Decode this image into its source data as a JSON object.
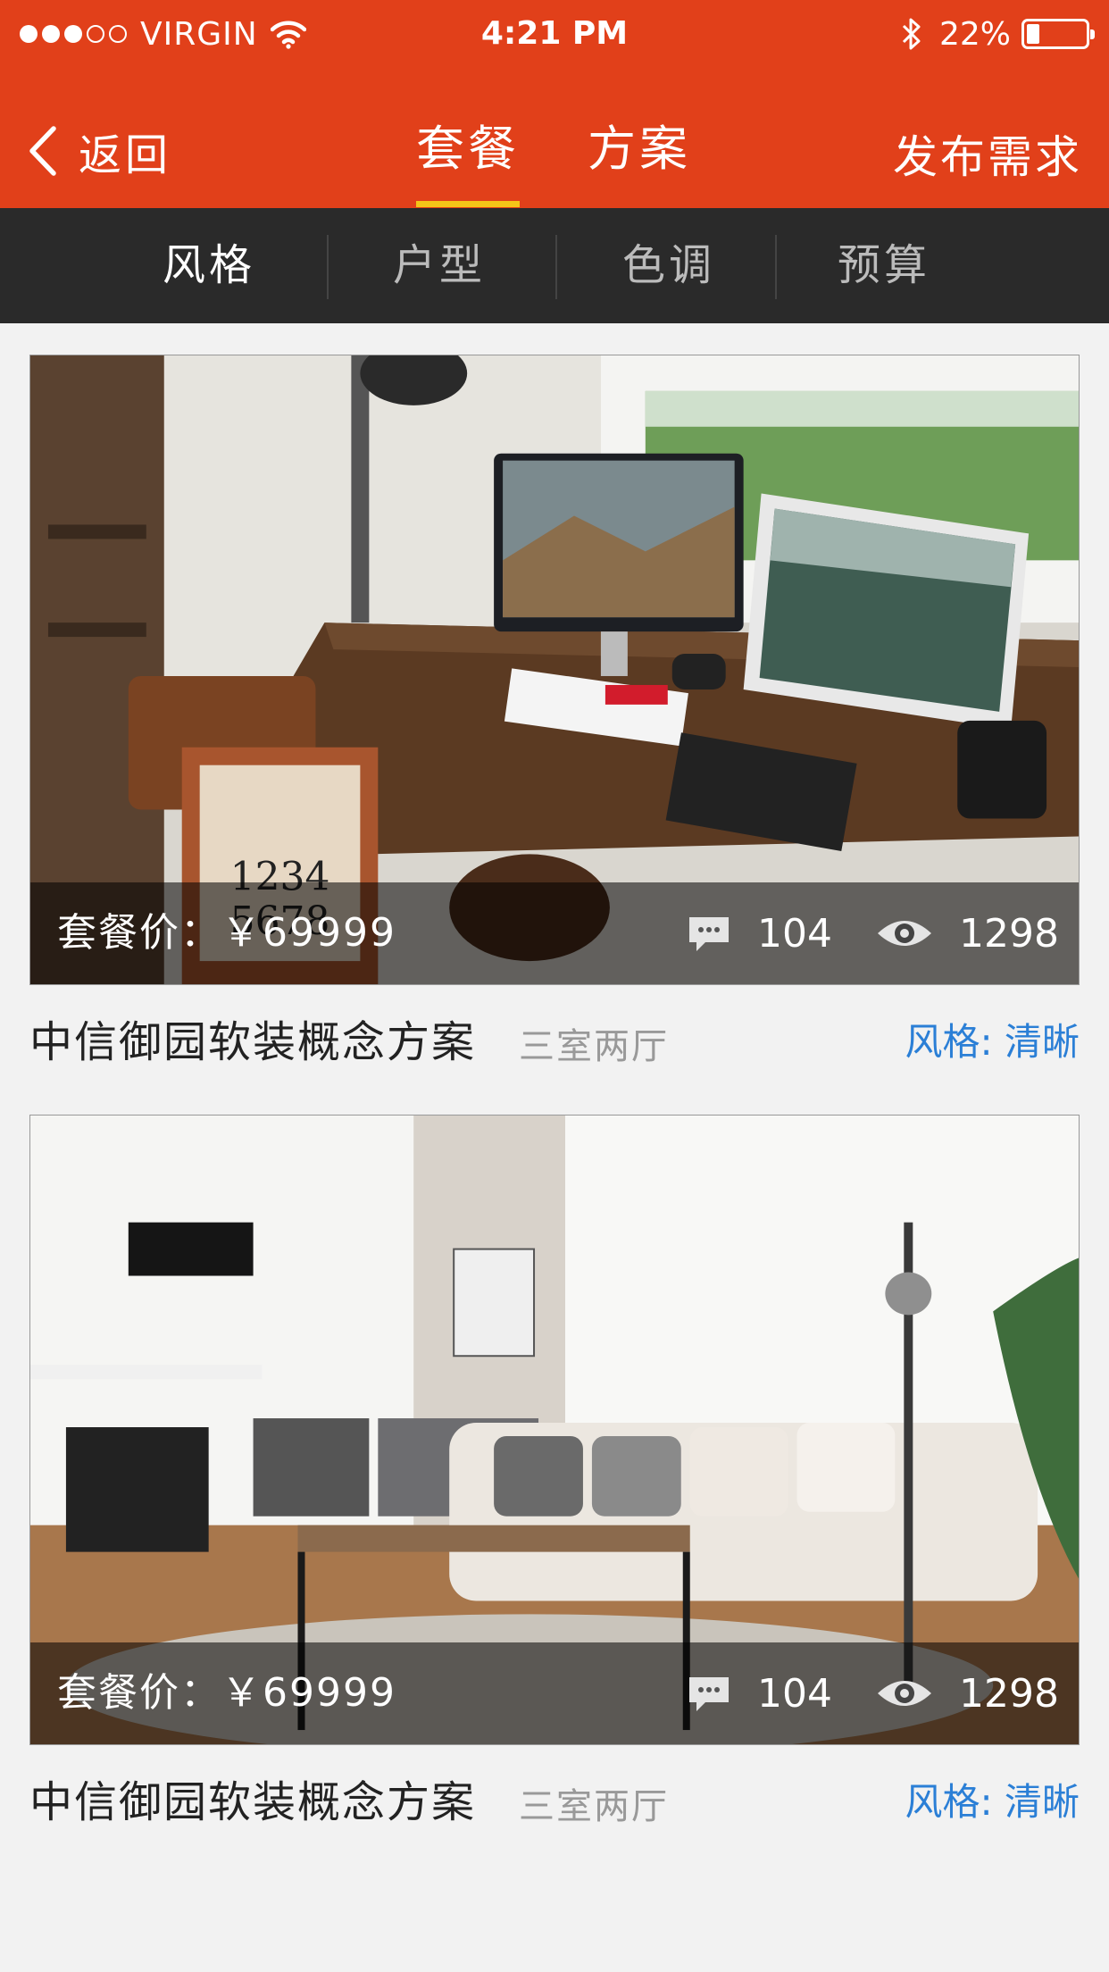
{
  "status_bar": {
    "carrier": "VIRGIN",
    "time": "4:21 PM",
    "battery_percent": "22%",
    "battery_level": 0.22,
    "signal_bars_filled": 3,
    "signal_bars_total": 5
  },
  "nav": {
    "back_label": "返回",
    "tabs": [
      {
        "label": "套餐",
        "active": true
      },
      {
        "label": "方案",
        "active": false
      }
    ],
    "publish_label": "发布需求",
    "accent_color": "#e1401a",
    "tab_indicator_color": "#f5c518"
  },
  "filters": [
    {
      "label": "风格",
      "active": true
    },
    {
      "label": "户型",
      "active": false
    },
    {
      "label": "色调",
      "active": false
    },
    {
      "label": "预算",
      "active": false
    }
  ],
  "cards": [
    {
      "price_text": "套餐价：￥69999",
      "comments": "104",
      "views": "1298",
      "title": "中信御园软装概念方案",
      "layout": "三室两厅",
      "style_text": "风格: 清晰",
      "image": "home-office-desk-photo"
    },
    {
      "price_text": "套餐价：￥69999",
      "comments": "104",
      "views": "1298",
      "title": "中信御园软装概念方案",
      "layout": "三室两厅",
      "style_text": "风格: 清晰",
      "image": "living-room-sofa-photo"
    }
  ],
  "colors": {
    "link_blue": "#2b7fd6",
    "filter_bar": "#2a2a2a"
  }
}
